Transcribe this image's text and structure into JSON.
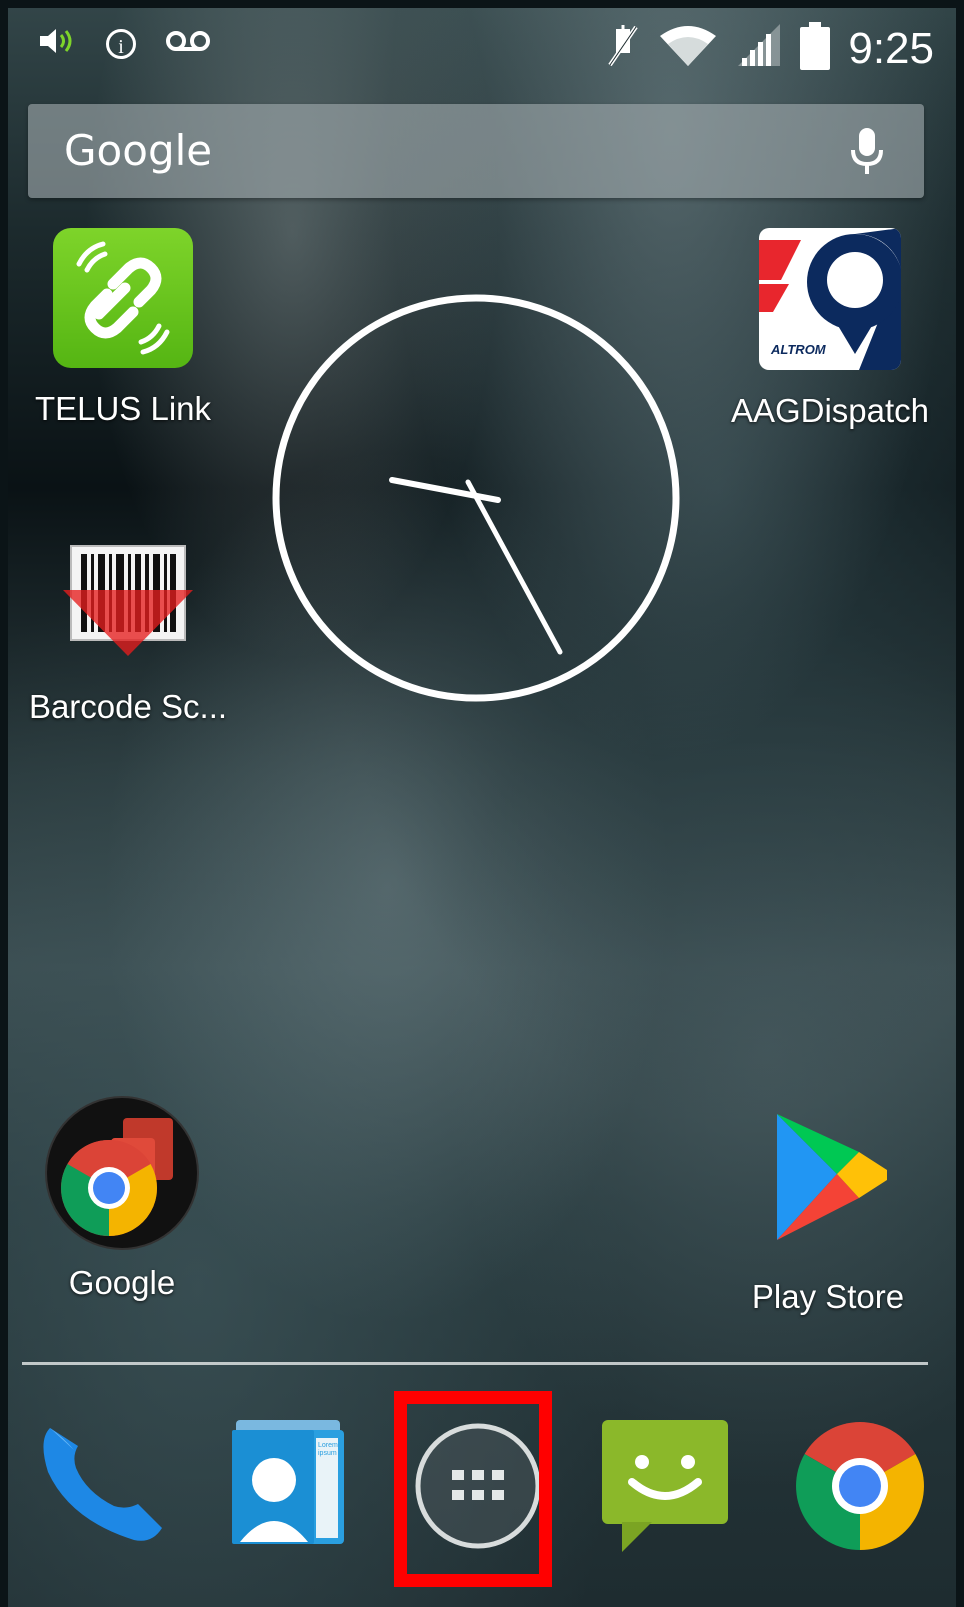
{
  "status_bar": {
    "time": "9:25",
    "left_icons": [
      "volume-icon",
      "info-icon",
      "voicemail-icon"
    ],
    "right_icons": [
      "mute-icon",
      "wifi-icon",
      "signal-icon",
      "battery-icon"
    ]
  },
  "search": {
    "label": "Google",
    "mic_icon": "mic-icon"
  },
  "apps": [
    {
      "label": "TELUS Link",
      "icon": "telus-link-icon"
    },
    {
      "label": "AAGDispatch",
      "icon": "aag-dispatch-icon"
    },
    {
      "label": "Barcode Sc...",
      "icon": "barcode-scanner-icon"
    },
    {
      "label": "Google",
      "icon": "google-folder-icon"
    },
    {
      "label": "Play Store",
      "icon": "play-store-icon"
    }
  ],
  "clock_widget": {
    "type": "analog",
    "hour_hand_time": "9:25"
  },
  "dock": {
    "items": [
      {
        "name": "phone",
        "icon": "phone-icon"
      },
      {
        "name": "contacts",
        "icon": "contacts-icon"
      },
      {
        "name": "app-drawer",
        "icon": "app-drawer-icon",
        "highlighted": true
      },
      {
        "name": "messaging",
        "icon": "messaging-icon"
      },
      {
        "name": "chrome",
        "icon": "chrome-icon"
      }
    ]
  },
  "contacts_card_text": "Lorem ipsum",
  "aag_logo_text": "ALTROM",
  "colors": {
    "highlight": "#ff0000",
    "telus_green": "#6cc524",
    "aag_navy": "#0c2a5e",
    "aag_red": "#e8262d"
  }
}
